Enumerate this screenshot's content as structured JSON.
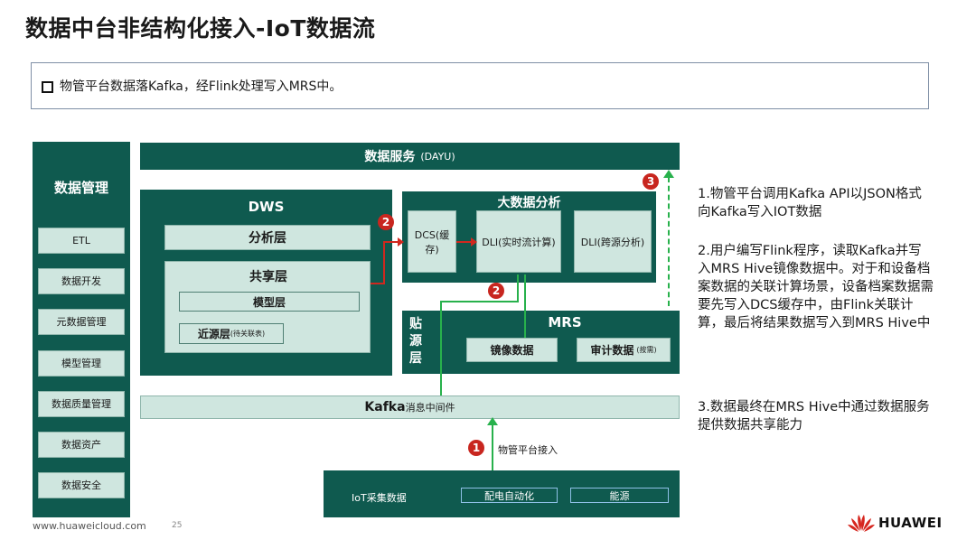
{
  "title": "数据中台非结构化接入-IoT数据流",
  "callout": {
    "text": "物管平台数据落Kafka，经Flink处理写入MRS中。"
  },
  "sidebar": {
    "title": "数据管理",
    "items": [
      "ETL",
      "数据开发",
      "元数据管理",
      "模型管理",
      "数据质量管理",
      "数据资产",
      "数据安全"
    ]
  },
  "diagram": {
    "data_service": {
      "label": "数据服务",
      "suffix": "(DAYU)"
    },
    "dws": {
      "title": "DWS",
      "analysis_layer": "分析层",
      "shared_layer": "共享层",
      "model_layer": "模型层",
      "source_layer": "近源层",
      "source_layer_note": "(待关联表)"
    },
    "bigdata": {
      "title": "大数据分析",
      "dcs": "DCS(缓存)",
      "dli_realtime": "DLI(实时流计算)",
      "dli_cross": "DLI(跨源分析)"
    },
    "mrs": {
      "side_label": "贴源层",
      "title": "MRS",
      "mirror": "镜像数据",
      "audit": "审计数据",
      "audit_note": "(按需)"
    },
    "kafka": {
      "label": "Kafka",
      "suffix": "消息中间件"
    },
    "iot": {
      "label": "IoT采集数据",
      "tag1": "配电自动化",
      "tag2": "能源"
    },
    "platform_access": "物管平台接入",
    "badges": [
      "1",
      "2",
      "2",
      "3"
    ]
  },
  "notes": [
    "1.物管平台调用Kafka API以JSON格式向Kafka写入IOT数据",
    "2.用户编写Flink程序，读取Kafka并写入MRS Hive镜像数据中。对于和设备档案数据的关联计算场景，设备档案数据需要先写入DCS缓存中，由Flink关联计算，最后将结果数据写入到MRS Hive中",
    "3.数据最终在MRS Hive中通过数据服务提供数据共享能力"
  ],
  "footer": {
    "url": "www.huaweicloud.com",
    "page": "25",
    "brand": "HUAWEI"
  },
  "colors": {
    "dark_teal": "#0f5a4f",
    "light_teal": "#cfe6df",
    "flow_green": "#28b14c",
    "red": "#d0281f"
  }
}
